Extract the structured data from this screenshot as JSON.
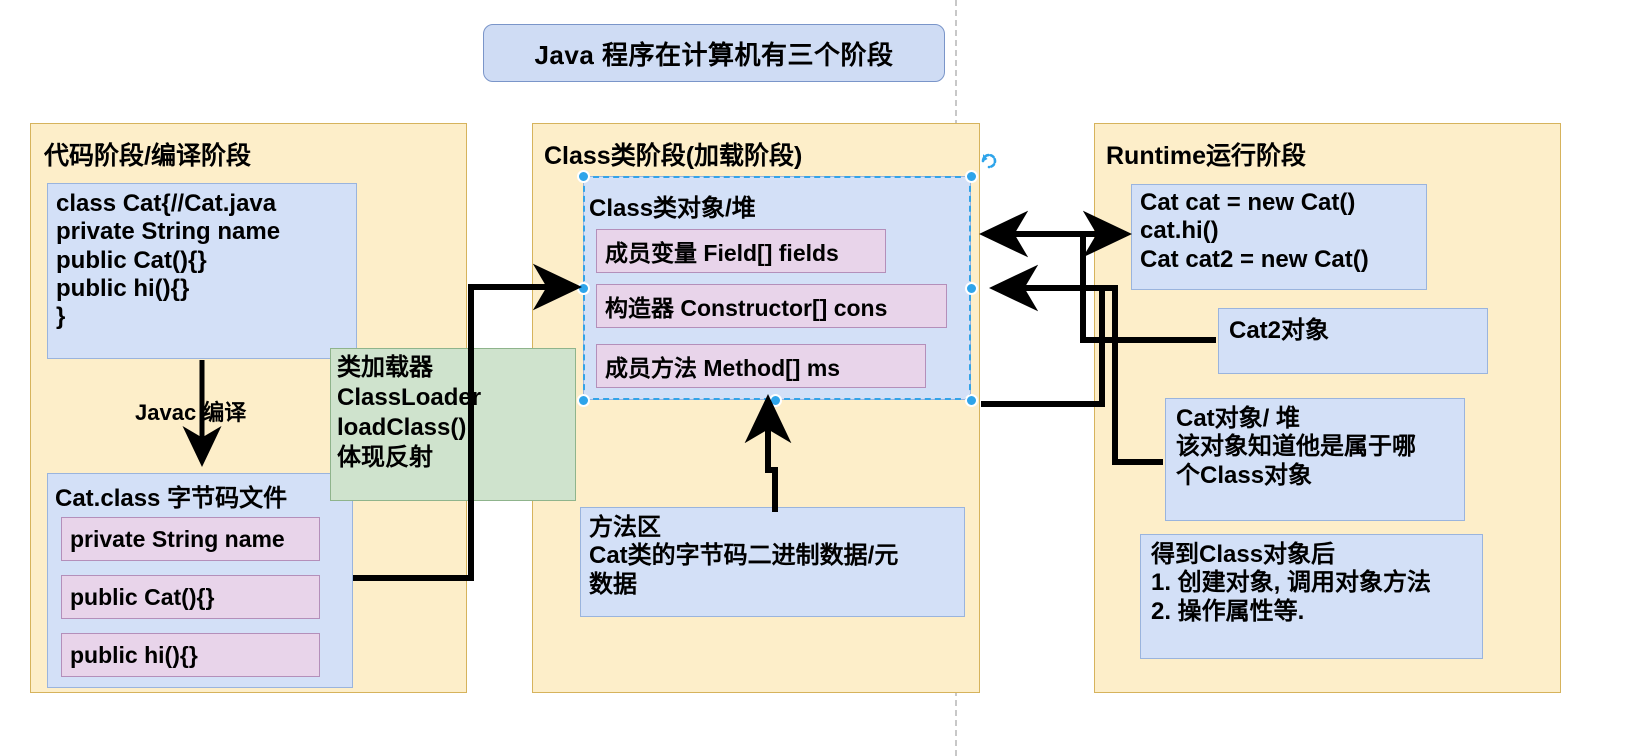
{
  "title": {
    "text": "Java 程序在计算机有三个阶段"
  },
  "stages": [
    {
      "id": "code",
      "title": "代码阶段/编译阶段"
    },
    {
      "id": "class",
      "title": "Class类阶段(加载阶段)"
    },
    {
      "id": "runtime",
      "title": "Runtime运行阶段"
    }
  ],
  "code_stage": {
    "source_box": "class Cat{//Cat.java\nprivate String name\npublic Cat(){}\npublic hi(){}\n}",
    "compile_label": "Javac 编译",
    "classfile_title": "Cat.class 字节码文件",
    "members": [
      "private String name",
      "public Cat(){}",
      "public hi(){}"
    ]
  },
  "classloader": {
    "text": "类加载器\nClassLoader\nloadClass()\n体现反射"
  },
  "class_stage": {
    "object_title": "Class类对象/堆",
    "members": [
      "成员变量 Field[] fields",
      "构造器 Constructor[] cons",
      "成员方法 Method[] ms"
    ],
    "method_area": "方法区\nCat类的字节码二进制数据/元\n数据"
  },
  "runtime_stage": {
    "code_box": "Cat cat = new Cat()\ncat.hi()\nCat cat2 = new Cat()",
    "cat2_object": "Cat2对象",
    "cat_object": "Cat对象/ 堆\n该对象知道他是属于哪\n个Class对象",
    "summary": "得到Class对象后\n1. 创建对象, 调用对象方法\n2. 操作属性等."
  },
  "selection": {
    "rotate_icon": "rotate-handle-icon",
    "handles": [
      "top-left",
      "top-center",
      "middle-left",
      "bottom-left",
      "bottom-center"
    ]
  },
  "colors": {
    "stage_fill": "#fdeec9",
    "stage_border": "#d6b35c",
    "blue_fill": "#d3e0f7",
    "blue_border": "#9ab4dd",
    "pink_fill": "#e8d4ea",
    "pink_border": "#b48fba",
    "green_fill": "#cfe3cd",
    "green_border": "#8fb48c",
    "title_fill": "#cfdcf4",
    "title_border": "#7a95c9",
    "selection": "#33a3e8",
    "arrow": "#000000",
    "guide": "#c8c8c8"
  }
}
